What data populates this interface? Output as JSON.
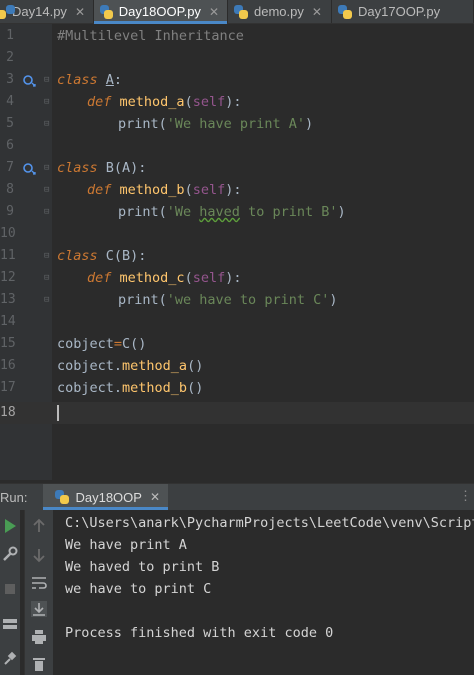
{
  "tabs": [
    {
      "label": "Day14.py",
      "active": false
    },
    {
      "label": "Day18OOP.py",
      "active": true
    },
    {
      "label": "demo.py",
      "active": false
    },
    {
      "label": "Day17OOP.py",
      "active": false
    }
  ],
  "editor": {
    "line_numbers": [
      "1",
      "2",
      "3",
      "4",
      "5",
      "6",
      "7",
      "8",
      "9",
      "10",
      "11",
      "12",
      "13",
      "14",
      "15",
      "16",
      "17",
      "18"
    ],
    "code": {
      "l1": "#Multilevel Inheritance",
      "l3_kw": "class",
      "l3_name": "A",
      "l3_colon": ":",
      "l4_kw": "def",
      "l4_fn": "method_a",
      "l4_open": "(",
      "l4_self": "self",
      "l4_close": "):",
      "l5_print": "print(",
      "l5_str": "'We have print A'",
      "l5_close": ")",
      "l7_kw": "class",
      "l7_name": "B(A)",
      "l7_colon": ":",
      "l8_kw": "def",
      "l8_fn": "method_b",
      "l8_open": "(",
      "l8_self": "self",
      "l8_close": "):",
      "l9_print": "print(",
      "l9_str_a": "'We ",
      "l9_str_b": "haved",
      "l9_str_c": " to print B'",
      "l9_close": ")",
      "l11_kw": "class",
      "l11_name": "C(B)",
      "l11_colon": ":",
      "l12_kw": "def",
      "l12_fn": "method_c",
      "l12_open": "(",
      "l12_self": "self",
      "l12_close": "):",
      "l13_print": "print(",
      "l13_str": "'we have to print C'",
      "l13_close": ")",
      "l15_var": "cobject",
      "l15_eq": "=",
      "l15_call": "C()",
      "l16_var": "cobject.",
      "l16_fn": "method_a",
      "l16_paren": "()",
      "l17_var": "cobject.",
      "l17_fn": "method_b",
      "l17_paren": "()"
    }
  },
  "run": {
    "label": "Run:",
    "tab": "Day18OOP",
    "output": [
      "C:\\Users\\anark\\PycharmProjects\\LeetCode\\venv\\Scripts\\",
      "We have print A",
      "We haved to print B",
      "we have to print C",
      "",
      "Process finished with exit code 0"
    ]
  },
  "colors": {
    "background": "#2b2b2b",
    "keyword": "#cc7832",
    "string": "#6a8759",
    "function": "#ffc66d",
    "self": "#94558d",
    "accent": "#4a88c7"
  }
}
